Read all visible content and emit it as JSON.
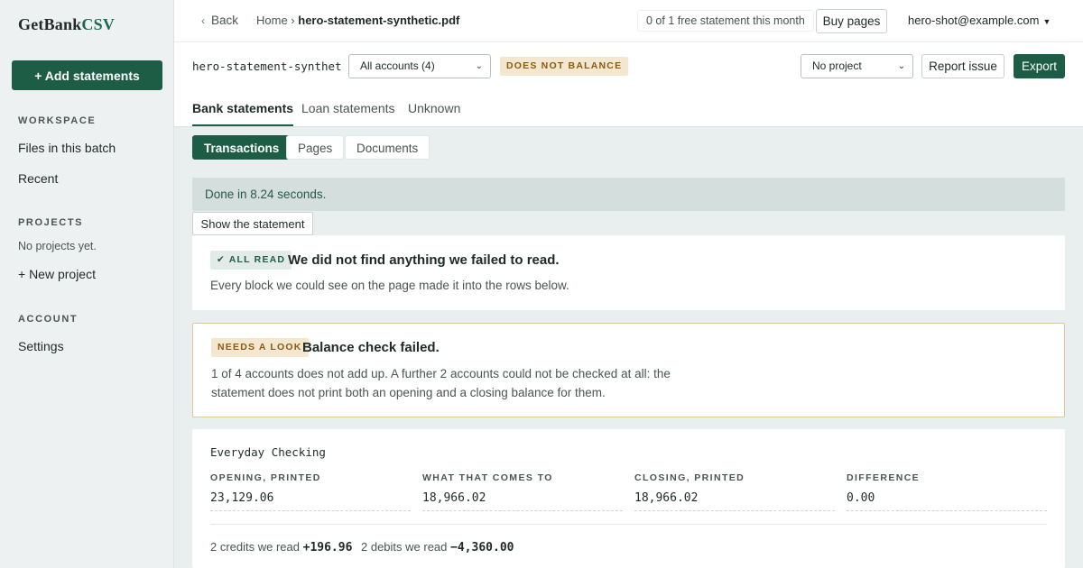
{
  "brand": {
    "name_main": "GetBank",
    "name_accent": "CSV"
  },
  "sidebar": {
    "add_button": "+ Add statements",
    "workspace_heading": "WORKSPACE",
    "workspace_items": [
      "Files in this batch",
      "Recent"
    ],
    "projects_heading": "PROJECTS",
    "projects_empty": "No projects yet.",
    "new_project": "+ New project",
    "account_heading": "ACCOUNT",
    "settings": "Settings"
  },
  "header": {
    "back": "Back",
    "breadcrumb_home": "Home ›",
    "breadcrumb_file": "hero-statement-synthetic.pdf",
    "free_quota": "0 of 1 free statement this month",
    "buy_pages": "Buy pages",
    "user_email": "hero-shot@example.com"
  },
  "toolbar": {
    "filename": "hero-statement-synthetic…",
    "accounts_select": "All accounts (4)",
    "balance_status": "DOES NOT BALANCE",
    "project_select": "No project",
    "report_issue": "Report issue",
    "export": "Export"
  },
  "tabs": [
    "Bank statements",
    "Loan statements",
    "Unknown"
  ],
  "views": [
    "Transactions",
    "Pages",
    "Documents"
  ],
  "status": {
    "done": "Done in 8.24 seconds.",
    "show_statement": "Show the statement"
  },
  "read_card": {
    "badge": "✔ ALL READ",
    "title": "We did not find anything we failed to read.",
    "text": "Every block we could see on the page made it into the rows below."
  },
  "balance_card": {
    "badge": "NEEDS A LOOK",
    "title": "Balance check failed.",
    "line1": "1 of 4 accounts does not add up. A further 2 accounts could not be checked at all: the",
    "line2": "statement does not print both an opening and a closing balance for them."
  },
  "account": {
    "name": "Everyday Checking",
    "columns": [
      {
        "label": "OPENING, PRINTED",
        "value": "23,129.06"
      },
      {
        "label": "WHAT THAT COMES TO",
        "value": "18,966.02"
      },
      {
        "label": "CLOSING, PRINTED",
        "value": "18,966.02"
      },
      {
        "label": "DIFFERENCE",
        "value": "0.00"
      }
    ],
    "credits_label": "2 credits we read",
    "credits_value": "+196.96",
    "debits_label": "2 debits we read",
    "debits_value": "−4,360.00"
  },
  "colors": {
    "brand_green": "#1d5d46",
    "warn_bg": "#f3e7cf",
    "warn_text": "#8a5a12"
  }
}
